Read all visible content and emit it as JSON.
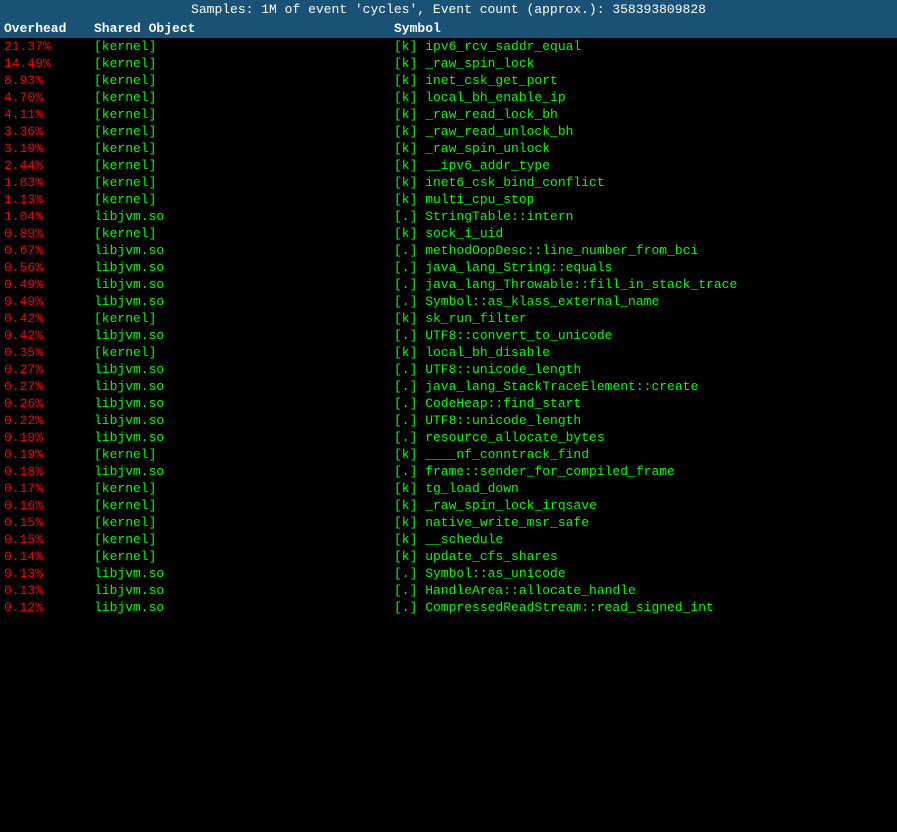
{
  "titleBar": {
    "text": "Samples: 1M of event 'cycles', Event count (approx.): 358393809828"
  },
  "header": {
    "overhead": "Overhead",
    "shared": "Shared Object",
    "symbol": "Symbol"
  },
  "rows": [
    {
      "overhead": "21.37%",
      "shared": "[kernel]",
      "symbol": "[k] ipv6_rcv_saddr_equal"
    },
    {
      "overhead": "14.49%",
      "shared": "[kernel]",
      "symbol": "[k] _raw_spin_lock"
    },
    {
      "overhead": "8.93%",
      "shared": "[kernel]",
      "symbol": "[k] inet_csk_get_port"
    },
    {
      "overhead": "4.70%",
      "shared": "[kernel]",
      "symbol": "[k] local_bh_enable_ip"
    },
    {
      "overhead": "4.11%",
      "shared": "[kernel]",
      "symbol": "[k] _raw_read_lock_bh"
    },
    {
      "overhead": "3.36%",
      "shared": "[kernel]",
      "symbol": "[k] _raw_read_unlock_bh"
    },
    {
      "overhead": "3.19%",
      "shared": "[kernel]",
      "symbol": "[k] _raw_spin_unlock"
    },
    {
      "overhead": "2.44%",
      "shared": "[kernel]",
      "symbol": "[k] __ipv6_addr_type"
    },
    {
      "overhead": "1.83%",
      "shared": "[kernel]",
      "symbol": "[k] inet6_csk_bind_conflict"
    },
    {
      "overhead": "1.13%",
      "shared": "[kernel]",
      "symbol": "[k] multi_cpu_stop"
    },
    {
      "overhead": "1.04%",
      "shared": "libjvm.so",
      "symbol": "[.] StringTable::intern"
    },
    {
      "overhead": "0.89%",
      "shared": "[kernel]",
      "symbol": "[k] sock_i_uid"
    },
    {
      "overhead": "0.67%",
      "shared": "libjvm.so",
      "symbol": "[.] methodOopDesc::line_number_from_bci"
    },
    {
      "overhead": "0.56%",
      "shared": "libjvm.so",
      "symbol": "[.] java_lang_String::equals"
    },
    {
      "overhead": "0.49%",
      "shared": "libjvm.so",
      "symbol": "[.] java_lang_Throwable::fill_in_stack_trace"
    },
    {
      "overhead": "0.49%",
      "shared": "libjvm.so",
      "symbol": "[.] Symbol::as_klass_external_name"
    },
    {
      "overhead": "0.42%",
      "shared": "[kernel]",
      "symbol": "[k] sk_run_filter"
    },
    {
      "overhead": "0.42%",
      "shared": "libjvm.so",
      "symbol": "[.] UTF8::convert_to_unicode"
    },
    {
      "overhead": "0.35%",
      "shared": "[kernel]",
      "symbol": "[k] local_bh_disable"
    },
    {
      "overhead": "0.27%",
      "shared": "libjvm.so",
      "symbol": "[.] UTF8::unicode_length"
    },
    {
      "overhead": "0.27%",
      "shared": "libjvm.so",
      "symbol": "[.] java_lang_StackTraceElement::create"
    },
    {
      "overhead": "0.26%",
      "shared": "libjvm.so",
      "symbol": "[.] CodeHeap::find_start"
    },
    {
      "overhead": "0.22%",
      "shared": "libjvm.so",
      "symbol": "[.] UTF8::unicode_length"
    },
    {
      "overhead": "0.19%",
      "shared": "libjvm.so",
      "symbol": "[.] resource_allocate_bytes"
    },
    {
      "overhead": "0.19%",
      "shared": "[kernel]",
      "symbol": "[k] ____nf_conntrack_find"
    },
    {
      "overhead": "0.18%",
      "shared": "libjvm.so",
      "symbol": "[.] frame::sender_for_compiled_frame"
    },
    {
      "overhead": "0.17%",
      "shared": "[kernel]",
      "symbol": "[k] tg_load_down"
    },
    {
      "overhead": "0.16%",
      "shared": "[kernel]",
      "symbol": "[k] _raw_spin_lock_irqsave"
    },
    {
      "overhead": "0.15%",
      "shared": "[kernel]",
      "symbol": "[k] native_write_msr_safe"
    },
    {
      "overhead": "0.15%",
      "shared": "[kernel]",
      "symbol": "[k] __schedule"
    },
    {
      "overhead": "0.14%",
      "shared": "[kernel]",
      "symbol": "[k] update_cfs_shares"
    },
    {
      "overhead": "0.13%",
      "shared": "libjvm.so",
      "symbol": "[.] Symbol::as_unicode"
    },
    {
      "overhead": "0.13%",
      "shared": "libjvm.so",
      "symbol": "[.] HandleArea::allocate_handle"
    },
    {
      "overhead": "0.12%",
      "shared": "libjvm.so",
      "symbol": "[.] CompressedReadStream::read_signed_int"
    }
  ]
}
